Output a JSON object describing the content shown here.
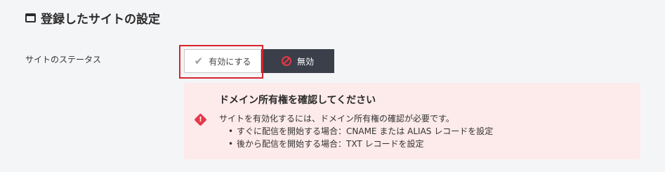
{
  "section": {
    "title": "登録したサイトの設定",
    "icon": "window-icon"
  },
  "status": {
    "label": "サイトのステータス",
    "enable_label": "有効にする",
    "disable_label": "無効",
    "enable_icon": "check-icon",
    "disable_icon": "ban-icon"
  },
  "alert": {
    "icon": "alert-diamond-icon",
    "title": "ドメイン所有権を確認してください",
    "message": "サイトを有効化するには、ドメイン所有権の確認が必要です。",
    "items": [
      "すぐに配信を開始する場合：CNAME または ALIAS レコードを設定",
      "後から配信を開始する場合：TXT レコードを設定"
    ]
  },
  "colors": {
    "highlight": "#d9232d",
    "alert_bg": "#fdeaea",
    "dark_button": "#3a3f4a",
    "danger": "#e53945"
  }
}
